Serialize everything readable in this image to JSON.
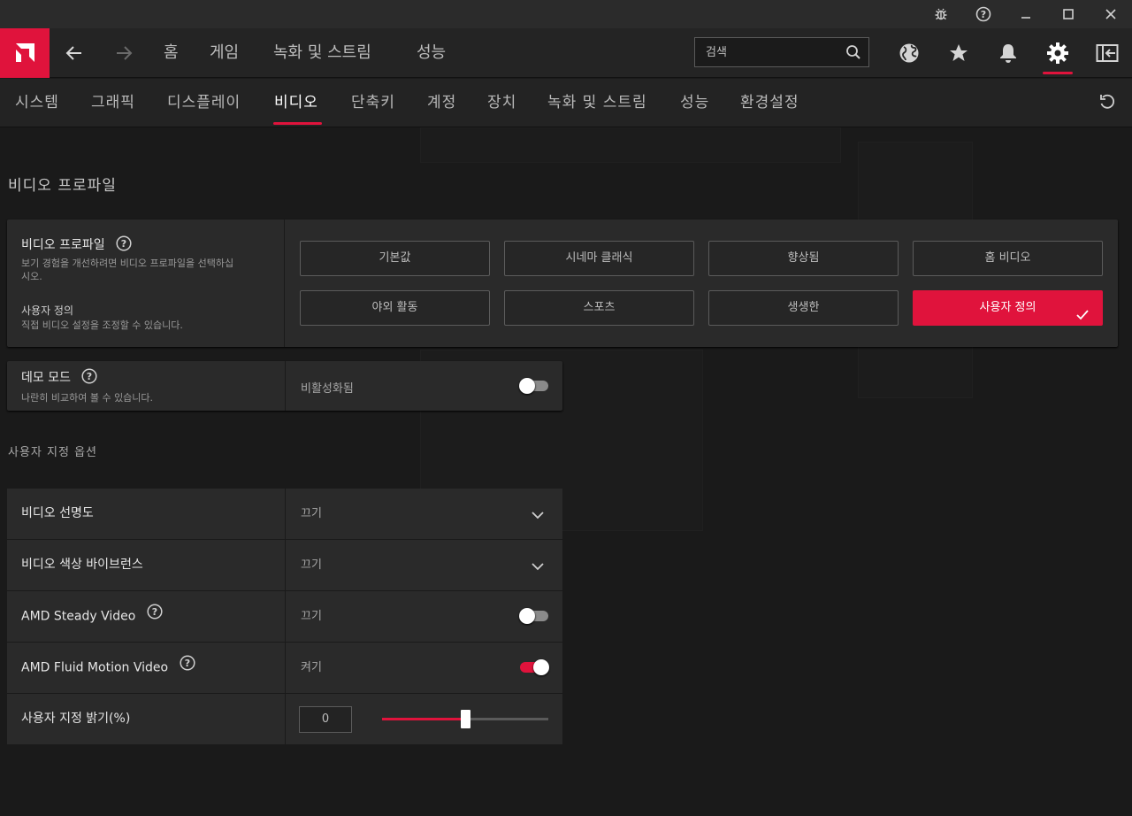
{
  "titlebar": {
    "icons": [
      "bug-icon",
      "help-icon",
      "minimize-icon",
      "maximize-icon",
      "close-icon"
    ]
  },
  "mainnav": {
    "logo": "amd-logo",
    "back": "back-arrow-icon",
    "forward": "forward-arrow-icon",
    "links": [
      "홈",
      "게임",
      "녹화 및 스트림",
      "성능"
    ],
    "search_placeholder": "검색",
    "icons": [
      "globe-icon",
      "star-icon",
      "bell-icon",
      "gear-icon",
      "sidebar-icon"
    ]
  },
  "subnav": {
    "tabs": [
      "시스템",
      "그래픽",
      "디스플레이",
      "비디오",
      "단축키",
      "계정",
      "장치",
      "녹화 및 스트림",
      "성능",
      "환경설정"
    ],
    "active_tab": "비디오",
    "reset_icon": "reset-icon"
  },
  "main": {
    "section_title": "비디오 프로파일",
    "profile_card": {
      "title": "비디오 프로파일",
      "desc": "보기 경험을 개선하려면 비디오 프로파일을 선택하십시오.",
      "current_title": "사용자 정의",
      "current_desc": "직접 비디오 설정을 조정할 수 있습니다.",
      "buttons": [
        "기본값",
        "시네마 클래식",
        "향상됨",
        "홈 비디오",
        "야외 활동",
        "스포츠",
        "생생한",
        "사용자 정의"
      ],
      "selected": "사용자 정의"
    },
    "demo_card": {
      "title": "데모 모드",
      "desc": "나란히 비교하여 볼 수 있습니다.",
      "value": "비활성화됨",
      "enabled": false
    },
    "custom_section_title": "사용자 지정 옵션",
    "options": [
      {
        "label": "비디오 선명도",
        "value": "끄기",
        "control": "dropdown"
      },
      {
        "label": "비디오 색상 바이브런스",
        "value": "끄기",
        "control": "dropdown"
      },
      {
        "label": "AMD Steady Video",
        "value": "끄기",
        "control": "toggle",
        "enabled": false
      },
      {
        "label": "AMD Fluid Motion Video",
        "value": "켜기",
        "control": "toggle",
        "enabled": true
      },
      {
        "label": "사용자 지정 밝기(%)",
        "value": "0",
        "control": "slider",
        "slider_fraction": 0.5
      }
    ]
  },
  "colors": {
    "accent": "#e0133c",
    "background": "#1a1a1a",
    "card": "#2a2a2a"
  }
}
